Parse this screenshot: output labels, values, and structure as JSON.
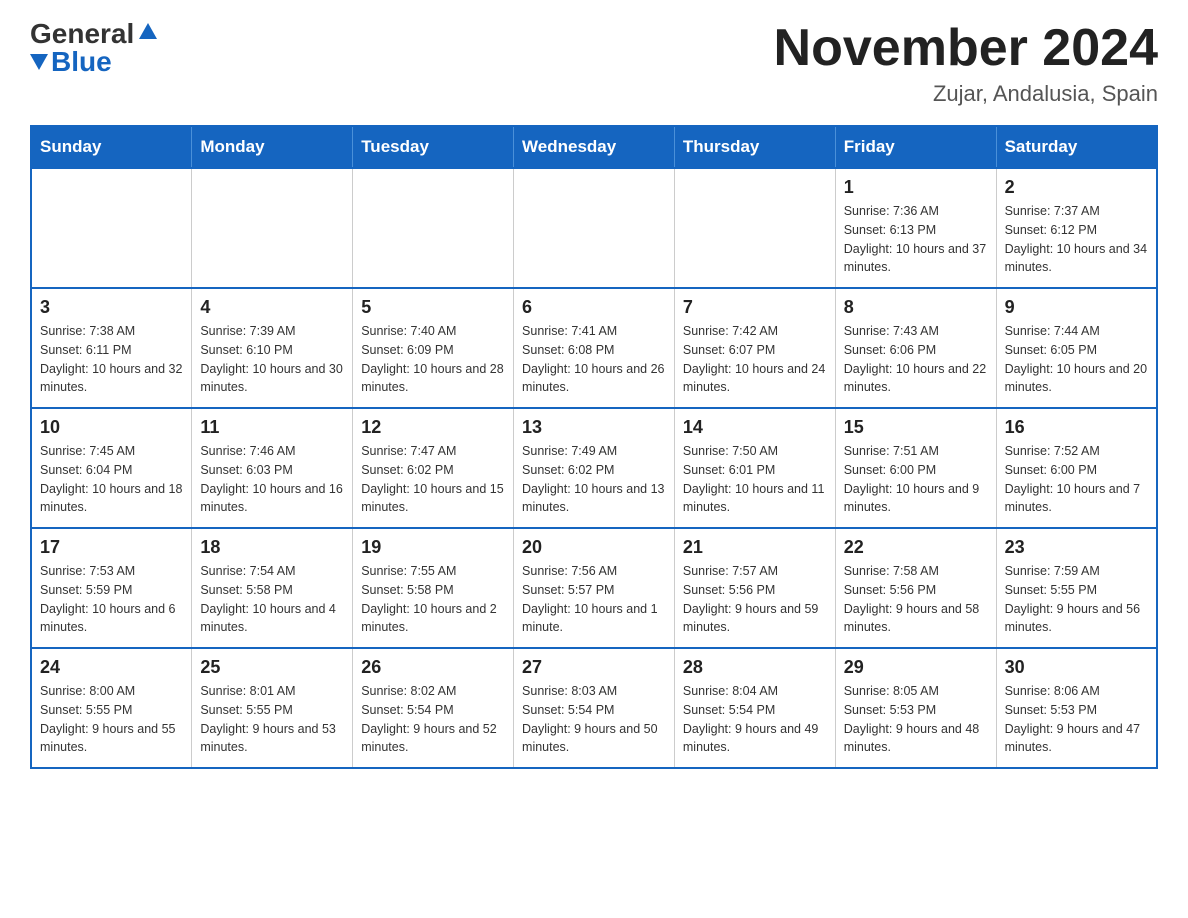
{
  "header": {
    "logo_general": "General",
    "logo_blue": "Blue",
    "month_title": "November 2024",
    "location": "Zujar, Andalusia, Spain"
  },
  "days_of_week": [
    "Sunday",
    "Monday",
    "Tuesday",
    "Wednesday",
    "Thursday",
    "Friday",
    "Saturday"
  ],
  "weeks": [
    [
      {
        "day": "",
        "info": ""
      },
      {
        "day": "",
        "info": ""
      },
      {
        "day": "",
        "info": ""
      },
      {
        "day": "",
        "info": ""
      },
      {
        "day": "",
        "info": ""
      },
      {
        "day": "1",
        "info": "Sunrise: 7:36 AM\nSunset: 6:13 PM\nDaylight: 10 hours and 37 minutes."
      },
      {
        "day": "2",
        "info": "Sunrise: 7:37 AM\nSunset: 6:12 PM\nDaylight: 10 hours and 34 minutes."
      }
    ],
    [
      {
        "day": "3",
        "info": "Sunrise: 7:38 AM\nSunset: 6:11 PM\nDaylight: 10 hours and 32 minutes."
      },
      {
        "day": "4",
        "info": "Sunrise: 7:39 AM\nSunset: 6:10 PM\nDaylight: 10 hours and 30 minutes."
      },
      {
        "day": "5",
        "info": "Sunrise: 7:40 AM\nSunset: 6:09 PM\nDaylight: 10 hours and 28 minutes."
      },
      {
        "day": "6",
        "info": "Sunrise: 7:41 AM\nSunset: 6:08 PM\nDaylight: 10 hours and 26 minutes."
      },
      {
        "day": "7",
        "info": "Sunrise: 7:42 AM\nSunset: 6:07 PM\nDaylight: 10 hours and 24 minutes."
      },
      {
        "day": "8",
        "info": "Sunrise: 7:43 AM\nSunset: 6:06 PM\nDaylight: 10 hours and 22 minutes."
      },
      {
        "day": "9",
        "info": "Sunrise: 7:44 AM\nSunset: 6:05 PM\nDaylight: 10 hours and 20 minutes."
      }
    ],
    [
      {
        "day": "10",
        "info": "Sunrise: 7:45 AM\nSunset: 6:04 PM\nDaylight: 10 hours and 18 minutes."
      },
      {
        "day": "11",
        "info": "Sunrise: 7:46 AM\nSunset: 6:03 PM\nDaylight: 10 hours and 16 minutes."
      },
      {
        "day": "12",
        "info": "Sunrise: 7:47 AM\nSunset: 6:02 PM\nDaylight: 10 hours and 15 minutes."
      },
      {
        "day": "13",
        "info": "Sunrise: 7:49 AM\nSunset: 6:02 PM\nDaylight: 10 hours and 13 minutes."
      },
      {
        "day": "14",
        "info": "Sunrise: 7:50 AM\nSunset: 6:01 PM\nDaylight: 10 hours and 11 minutes."
      },
      {
        "day": "15",
        "info": "Sunrise: 7:51 AM\nSunset: 6:00 PM\nDaylight: 10 hours and 9 minutes."
      },
      {
        "day": "16",
        "info": "Sunrise: 7:52 AM\nSunset: 6:00 PM\nDaylight: 10 hours and 7 minutes."
      }
    ],
    [
      {
        "day": "17",
        "info": "Sunrise: 7:53 AM\nSunset: 5:59 PM\nDaylight: 10 hours and 6 minutes."
      },
      {
        "day": "18",
        "info": "Sunrise: 7:54 AM\nSunset: 5:58 PM\nDaylight: 10 hours and 4 minutes."
      },
      {
        "day": "19",
        "info": "Sunrise: 7:55 AM\nSunset: 5:58 PM\nDaylight: 10 hours and 2 minutes."
      },
      {
        "day": "20",
        "info": "Sunrise: 7:56 AM\nSunset: 5:57 PM\nDaylight: 10 hours and 1 minute."
      },
      {
        "day": "21",
        "info": "Sunrise: 7:57 AM\nSunset: 5:56 PM\nDaylight: 9 hours and 59 minutes."
      },
      {
        "day": "22",
        "info": "Sunrise: 7:58 AM\nSunset: 5:56 PM\nDaylight: 9 hours and 58 minutes."
      },
      {
        "day": "23",
        "info": "Sunrise: 7:59 AM\nSunset: 5:55 PM\nDaylight: 9 hours and 56 minutes."
      }
    ],
    [
      {
        "day": "24",
        "info": "Sunrise: 8:00 AM\nSunset: 5:55 PM\nDaylight: 9 hours and 55 minutes."
      },
      {
        "day": "25",
        "info": "Sunrise: 8:01 AM\nSunset: 5:55 PM\nDaylight: 9 hours and 53 minutes."
      },
      {
        "day": "26",
        "info": "Sunrise: 8:02 AM\nSunset: 5:54 PM\nDaylight: 9 hours and 52 minutes."
      },
      {
        "day": "27",
        "info": "Sunrise: 8:03 AM\nSunset: 5:54 PM\nDaylight: 9 hours and 50 minutes."
      },
      {
        "day": "28",
        "info": "Sunrise: 8:04 AM\nSunset: 5:54 PM\nDaylight: 9 hours and 49 minutes."
      },
      {
        "day": "29",
        "info": "Sunrise: 8:05 AM\nSunset: 5:53 PM\nDaylight: 9 hours and 48 minutes."
      },
      {
        "day": "30",
        "info": "Sunrise: 8:06 AM\nSunset: 5:53 PM\nDaylight: 9 hours and 47 minutes."
      }
    ]
  ]
}
